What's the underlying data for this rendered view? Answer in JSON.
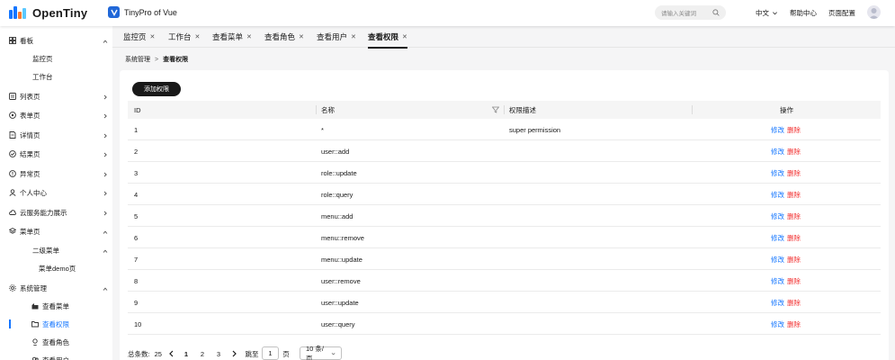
{
  "header": {
    "brand": "OpenTiny",
    "product": "TinyPro of Vue",
    "search_placeholder": "请输入关键词",
    "language": "中文",
    "help": "帮助中心",
    "page_config": "页面配置"
  },
  "sidebar": {
    "items": [
      {
        "label": "看板",
        "icon": "dashboard-icon",
        "arrow": "up"
      },
      {
        "label": "监控页",
        "icon": "",
        "arrow": ""
      },
      {
        "label": "工作台",
        "icon": "",
        "arrow": ""
      },
      {
        "label": "列表页",
        "icon": "list-icon",
        "arrow": "right"
      },
      {
        "label": "表单页",
        "icon": "form-icon",
        "arrow": "right"
      },
      {
        "label": "详情页",
        "icon": "detail-icon",
        "arrow": "right"
      },
      {
        "label": "结果页",
        "icon": "result-icon",
        "arrow": "right"
      },
      {
        "label": "异常页",
        "icon": "exception-icon",
        "arrow": "right"
      },
      {
        "label": "个人中心",
        "icon": "user-icon",
        "arrow": "right"
      },
      {
        "label": "云服务能力展示",
        "icon": "cloud-icon",
        "arrow": "right"
      },
      {
        "label": "菜单页",
        "icon": "menu-icon",
        "arrow": "up"
      },
      {
        "label": "二级菜单",
        "icon": "",
        "arrow": "up"
      },
      {
        "label": "菜单demo页",
        "icon": "",
        "arrow": ""
      },
      {
        "label": "系统管理",
        "icon": "system-icon",
        "arrow": "up"
      },
      {
        "label": "查看菜单",
        "icon": "view-menu-icon",
        "arrow": ""
      },
      {
        "label": "查看权限",
        "icon": "folder-icon",
        "arrow": ""
      },
      {
        "label": "查看角色",
        "icon": "role-icon",
        "arrow": ""
      },
      {
        "label": "查看用户",
        "icon": "users-icon",
        "arrow": ""
      }
    ],
    "active_index": 15
  },
  "tabs": [
    {
      "label": "监控页"
    },
    {
      "label": "工作台"
    },
    {
      "label": "查看菜单"
    },
    {
      "label": "查看角色"
    },
    {
      "label": "查看用户"
    },
    {
      "label": "查看权限"
    }
  ],
  "active_tab": 5,
  "breadcrumb": {
    "parent": "系统管理",
    "separator": ">",
    "current": "查看权限"
  },
  "toolbar": {
    "add_label": "添加权限"
  },
  "table": {
    "columns": [
      "ID",
      "名称",
      "权限描述",
      "操作"
    ],
    "rows": [
      {
        "id": "1",
        "name": "*",
        "desc": "super permission"
      },
      {
        "id": "2",
        "name": "user::add",
        "desc": ""
      },
      {
        "id": "3",
        "name": "role::update",
        "desc": ""
      },
      {
        "id": "4",
        "name": "role::query",
        "desc": ""
      },
      {
        "id": "5",
        "name": "menu::add",
        "desc": ""
      },
      {
        "id": "6",
        "name": "menu::remove",
        "desc": ""
      },
      {
        "id": "7",
        "name": "menu::update",
        "desc": ""
      },
      {
        "id": "8",
        "name": "user::remove",
        "desc": ""
      },
      {
        "id": "9",
        "name": "user::update",
        "desc": ""
      },
      {
        "id": "10",
        "name": "user::query",
        "desc": ""
      }
    ],
    "edit_label": "修改",
    "delete_label": "删除"
  },
  "pager": {
    "total_label": "总条数:",
    "total": "25",
    "pages": [
      "1",
      "2",
      "3"
    ],
    "current_page": "1",
    "goto_label": "跳至",
    "goto_value": "1",
    "page_unit": "页",
    "page_size": "10 条/页"
  },
  "colors": {
    "accent": "#1476ff",
    "danger": "#f23030",
    "dark": "#191919"
  }
}
